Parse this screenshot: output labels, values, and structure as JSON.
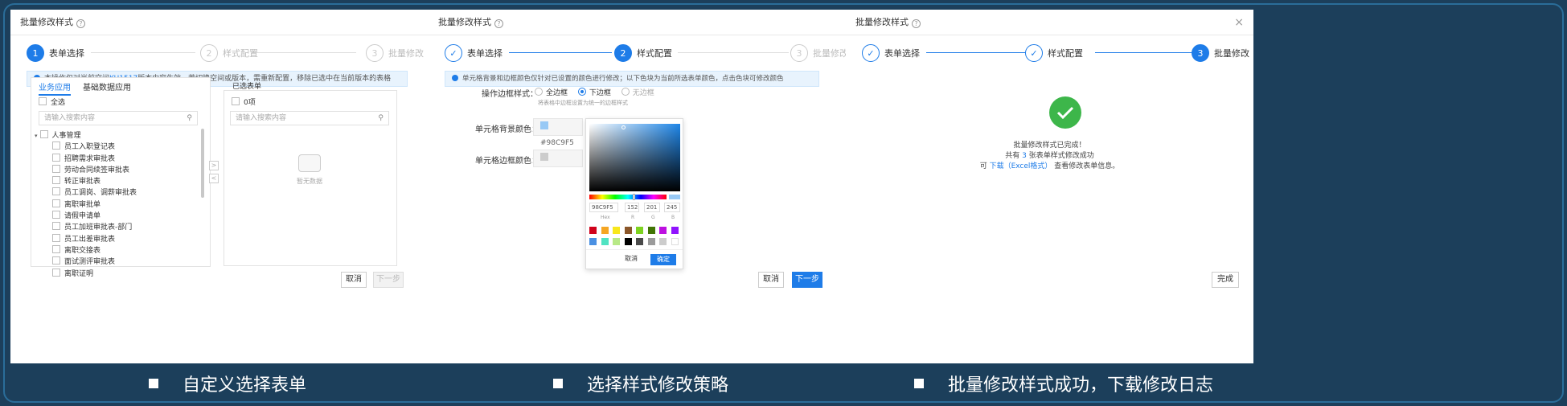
{
  "dialog": {
    "title": "批量修改样式",
    "close": "×",
    "help": "?"
  },
  "steps": [
    {
      "num": "1",
      "label": "表单选择"
    },
    {
      "num": "2",
      "label": "样式配置"
    },
    {
      "num": "3",
      "label": "批量修改"
    }
  ],
  "panel1": {
    "info_prefix": "本操作仅对当前空间",
    "info_link": "KU1517",
    "info_suffix": "版本内容生效，若切换空间或版本，需重新配置，移除已选中在当前版本的表格",
    "tabs": [
      "业务应用",
      "基础数据应用"
    ],
    "select_all": "全选",
    "search_placeholder": "请输入搜索内容",
    "tree_root": "人事管理",
    "tree_items": [
      "员工入职登记表",
      "招聘需求审批表",
      "劳动合同续签审批表",
      "转正审批表",
      "员工调岗、调薪审批表",
      "离职审批单",
      "请假申请单",
      "员工加班审批表-部门",
      "员工出差审批表",
      "离职交接表",
      "面试测评审批表",
      "离职证明"
    ],
    "selected_title": "已选表单",
    "selected_count": "0项",
    "selected_search_placeholder": "请输入搜索内容",
    "empty_text": "暂无数据",
    "transfer_right": ">",
    "transfer_left": "<",
    "cancel": "取消",
    "next": "下一步"
  },
  "panel2": {
    "info": "单元格背景和边框颜色仅针对已设置的颜色进行修改；以下色块为当前所选表单颜色，点击色块可修改颜色",
    "border_label": "操作边框样式：",
    "border_options": [
      "全边框",
      "下边框",
      "无边框"
    ],
    "border_hint": "将表格中边框设置为统一的边框样式",
    "bg_label": "单元格背景颜色：",
    "bg_value": "#98C9F5",
    "border_color_label": "单元格边框颜色：",
    "border_color_value": "#CCCCCC",
    "picker": {
      "hex": "98C9F5",
      "r": "152",
      "g": "201",
      "b": "245",
      "hex_label": "Hex",
      "r_label": "R",
      "g_label": "G",
      "b_label": "B",
      "cancel": "取消",
      "ok": "确定",
      "presets_row1": [
        "#d0021b",
        "#f5a623",
        "#f8e71c",
        "#8b572a",
        "#7ed321",
        "#417505",
        "#bd10e0",
        "#9013fe"
      ],
      "presets_row2": [
        "#4a90e2",
        "#50e3c2",
        "#b8e986",
        "#000000",
        "#4a4a4a",
        "#9b9b9b",
        "#cccccc",
        "#ffffff"
      ]
    },
    "cancel": "取消",
    "next": "下一步"
  },
  "panel3": {
    "line1": "批量修改样式已完成！",
    "line2_prefix": "共有 ",
    "line2_count": "3",
    "line2_suffix": " 张表单样式修改成功",
    "line3_prefix": "可 ",
    "line3_link": "下载（Excel格式）",
    "line3_suffix": " 查看修改表单信息。",
    "done": "完成"
  },
  "captions": [
    "自定义选择表单",
    "选择样式修改策略",
    "批量修改样式成功，下载修改日志"
  ],
  "colors": {
    "accent": "#1e7ce8",
    "success": "#3db64a",
    "bg": "#1c3f5b"
  }
}
